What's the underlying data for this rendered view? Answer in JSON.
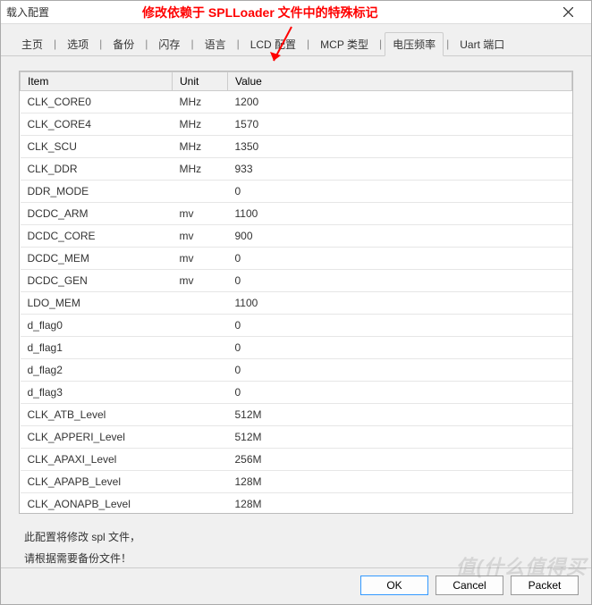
{
  "window": {
    "title": "载入配置"
  },
  "annotation": "修改依赖于 SPLLoader 文件中的特殊标记",
  "tabs": [
    "主页",
    "选项",
    "备份",
    "闪存",
    "语言",
    "LCD 配置",
    "MCP 类型",
    "电压频率",
    "Uart 端口"
  ],
  "active_tab_index": 7,
  "table": {
    "headers": [
      "Item",
      "Unit",
      "Value"
    ],
    "rows": [
      {
        "item": "CLK_CORE0",
        "unit": "MHz",
        "value": "1200"
      },
      {
        "item": "CLK_CORE4",
        "unit": "MHz",
        "value": "1570"
      },
      {
        "item": "CLK_SCU",
        "unit": "MHz",
        "value": "1350"
      },
      {
        "item": "CLK_DDR",
        "unit": "MHz",
        "value": "933"
      },
      {
        "item": "DDR_MODE",
        "unit": "",
        "value": "0"
      },
      {
        "item": "DCDC_ARM",
        "unit": "mv",
        "value": "1100"
      },
      {
        "item": "DCDC_CORE",
        "unit": "mv",
        "value": "900"
      },
      {
        "item": "DCDC_MEM",
        "unit": "mv",
        "value": "0"
      },
      {
        "item": "DCDC_GEN",
        "unit": "mv",
        "value": "0"
      },
      {
        "item": "LDO_MEM",
        "unit": "",
        "value": "1100"
      },
      {
        "item": "d_flag0",
        "unit": "",
        "value": "0"
      },
      {
        "item": "d_flag1",
        "unit": "",
        "value": "0"
      },
      {
        "item": "d_flag2",
        "unit": "",
        "value": "0"
      },
      {
        "item": "d_flag3",
        "unit": "",
        "value": "0"
      },
      {
        "item": "CLK_ATB_Level",
        "unit": "",
        "value": "512M"
      },
      {
        "item": "CLK_APPERI_Level",
        "unit": "",
        "value": "512M"
      },
      {
        "item": "CLK_APAXI_Level",
        "unit": "",
        "value": "256M"
      },
      {
        "item": "CLK_APAPB_Level",
        "unit": "",
        "value": "128M"
      },
      {
        "item": "CLK_AONAPB_Level",
        "unit": "",
        "value": "128M"
      }
    ]
  },
  "notes": {
    "line1": "此配置将修改 spl 文件，",
    "line2": "请根据需要备份文件！"
  },
  "buttons": {
    "ok": "OK",
    "cancel": "Cancel",
    "packet": "Packet"
  },
  "watermark": "值(什么值得买"
}
